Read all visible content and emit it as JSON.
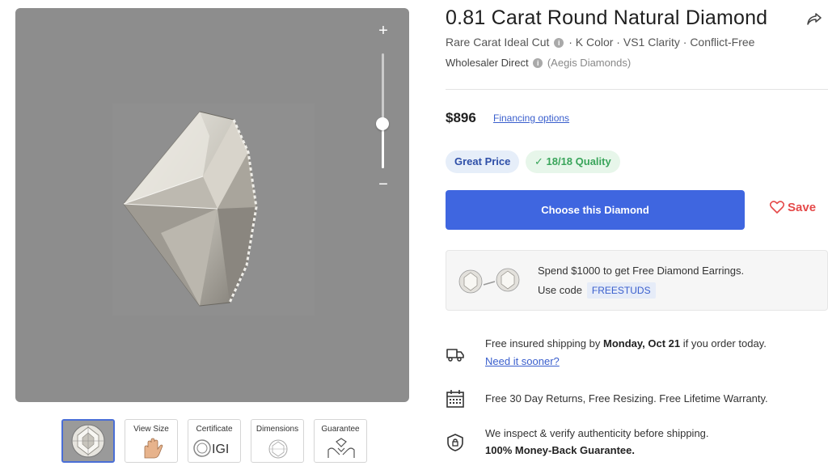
{
  "product": {
    "title": "0.81 Carat Round Natural Diamond",
    "cut": "Rare Carat Ideal Cut",
    "specs": "· K Color · VS1 Clarity · Conflict-Free",
    "vendor": "Wholesaler Direct",
    "vendor_name": "(Aegis Diamonds)",
    "price": "$896",
    "financing_label": "Financing options"
  },
  "badges": {
    "price": "Great Price",
    "quality": "✓ 18/18 Quality"
  },
  "actions": {
    "choose_label": "Choose this Diamond",
    "save_label": "Save"
  },
  "promo": {
    "line1": "Spend $1000 to get Free Diamond Earrings.",
    "line2": "Use code",
    "code": "FREESTUDS"
  },
  "shipping": {
    "prefix": "Free insured shipping by",
    "date": "Monday, Oct 21",
    "suffix": "if you order today.",
    "link": "Need it sooner?"
  },
  "returns": {
    "text": "Free 30 Day Returns, Free Resizing. Free Lifetime Warranty."
  },
  "guarantee": {
    "line1": "We inspect & verify authenticity before shipping.",
    "line2": "100% Money-Back Guarantee."
  },
  "viewer": {
    "zoom_in": "+",
    "zoom_out": "−",
    "zoom_level": 0.6
  },
  "thumbnails": [
    {
      "label": "",
      "icon": "diamond-photo"
    },
    {
      "label": "View Size",
      "icon": "hand-icon"
    },
    {
      "label": "Certificate",
      "icon": "igi-logo",
      "logo_text": "IGI"
    },
    {
      "label": "Dimensions",
      "icon": "dimensions-icon"
    },
    {
      "label": "Guarantee",
      "icon": "guarantee-icon"
    }
  ],
  "colors": {
    "primary": "#3f66e0",
    "link": "#3a5fcd",
    "save": "#e54a4a",
    "quality": "#3aa55b",
    "viewer_bg": "#8d8d8d"
  }
}
